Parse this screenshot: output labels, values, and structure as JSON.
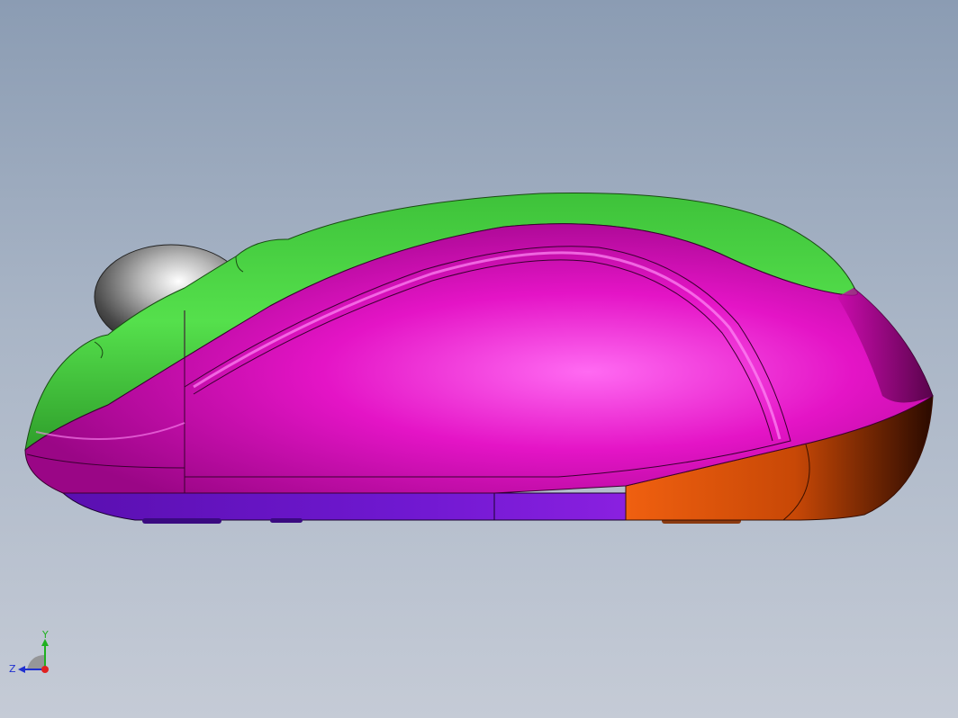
{
  "viewport": {
    "background_top": "#8b9cb3",
    "background_bottom": "#c5cbd6"
  },
  "model": {
    "colors": {
      "top_shell": "#3fd43a",
      "side_shell": "#e010c0",
      "bottom_band": "#6a12c8",
      "rear_cap": "#e05a08",
      "scroll_wheel": "#6f6f6f"
    }
  },
  "triad": {
    "y_label": "Y",
    "z_label": "Z",
    "x_axis_color": "#e02020",
    "y_axis_color": "#20b020",
    "z_axis_color": "#2030d0"
  }
}
